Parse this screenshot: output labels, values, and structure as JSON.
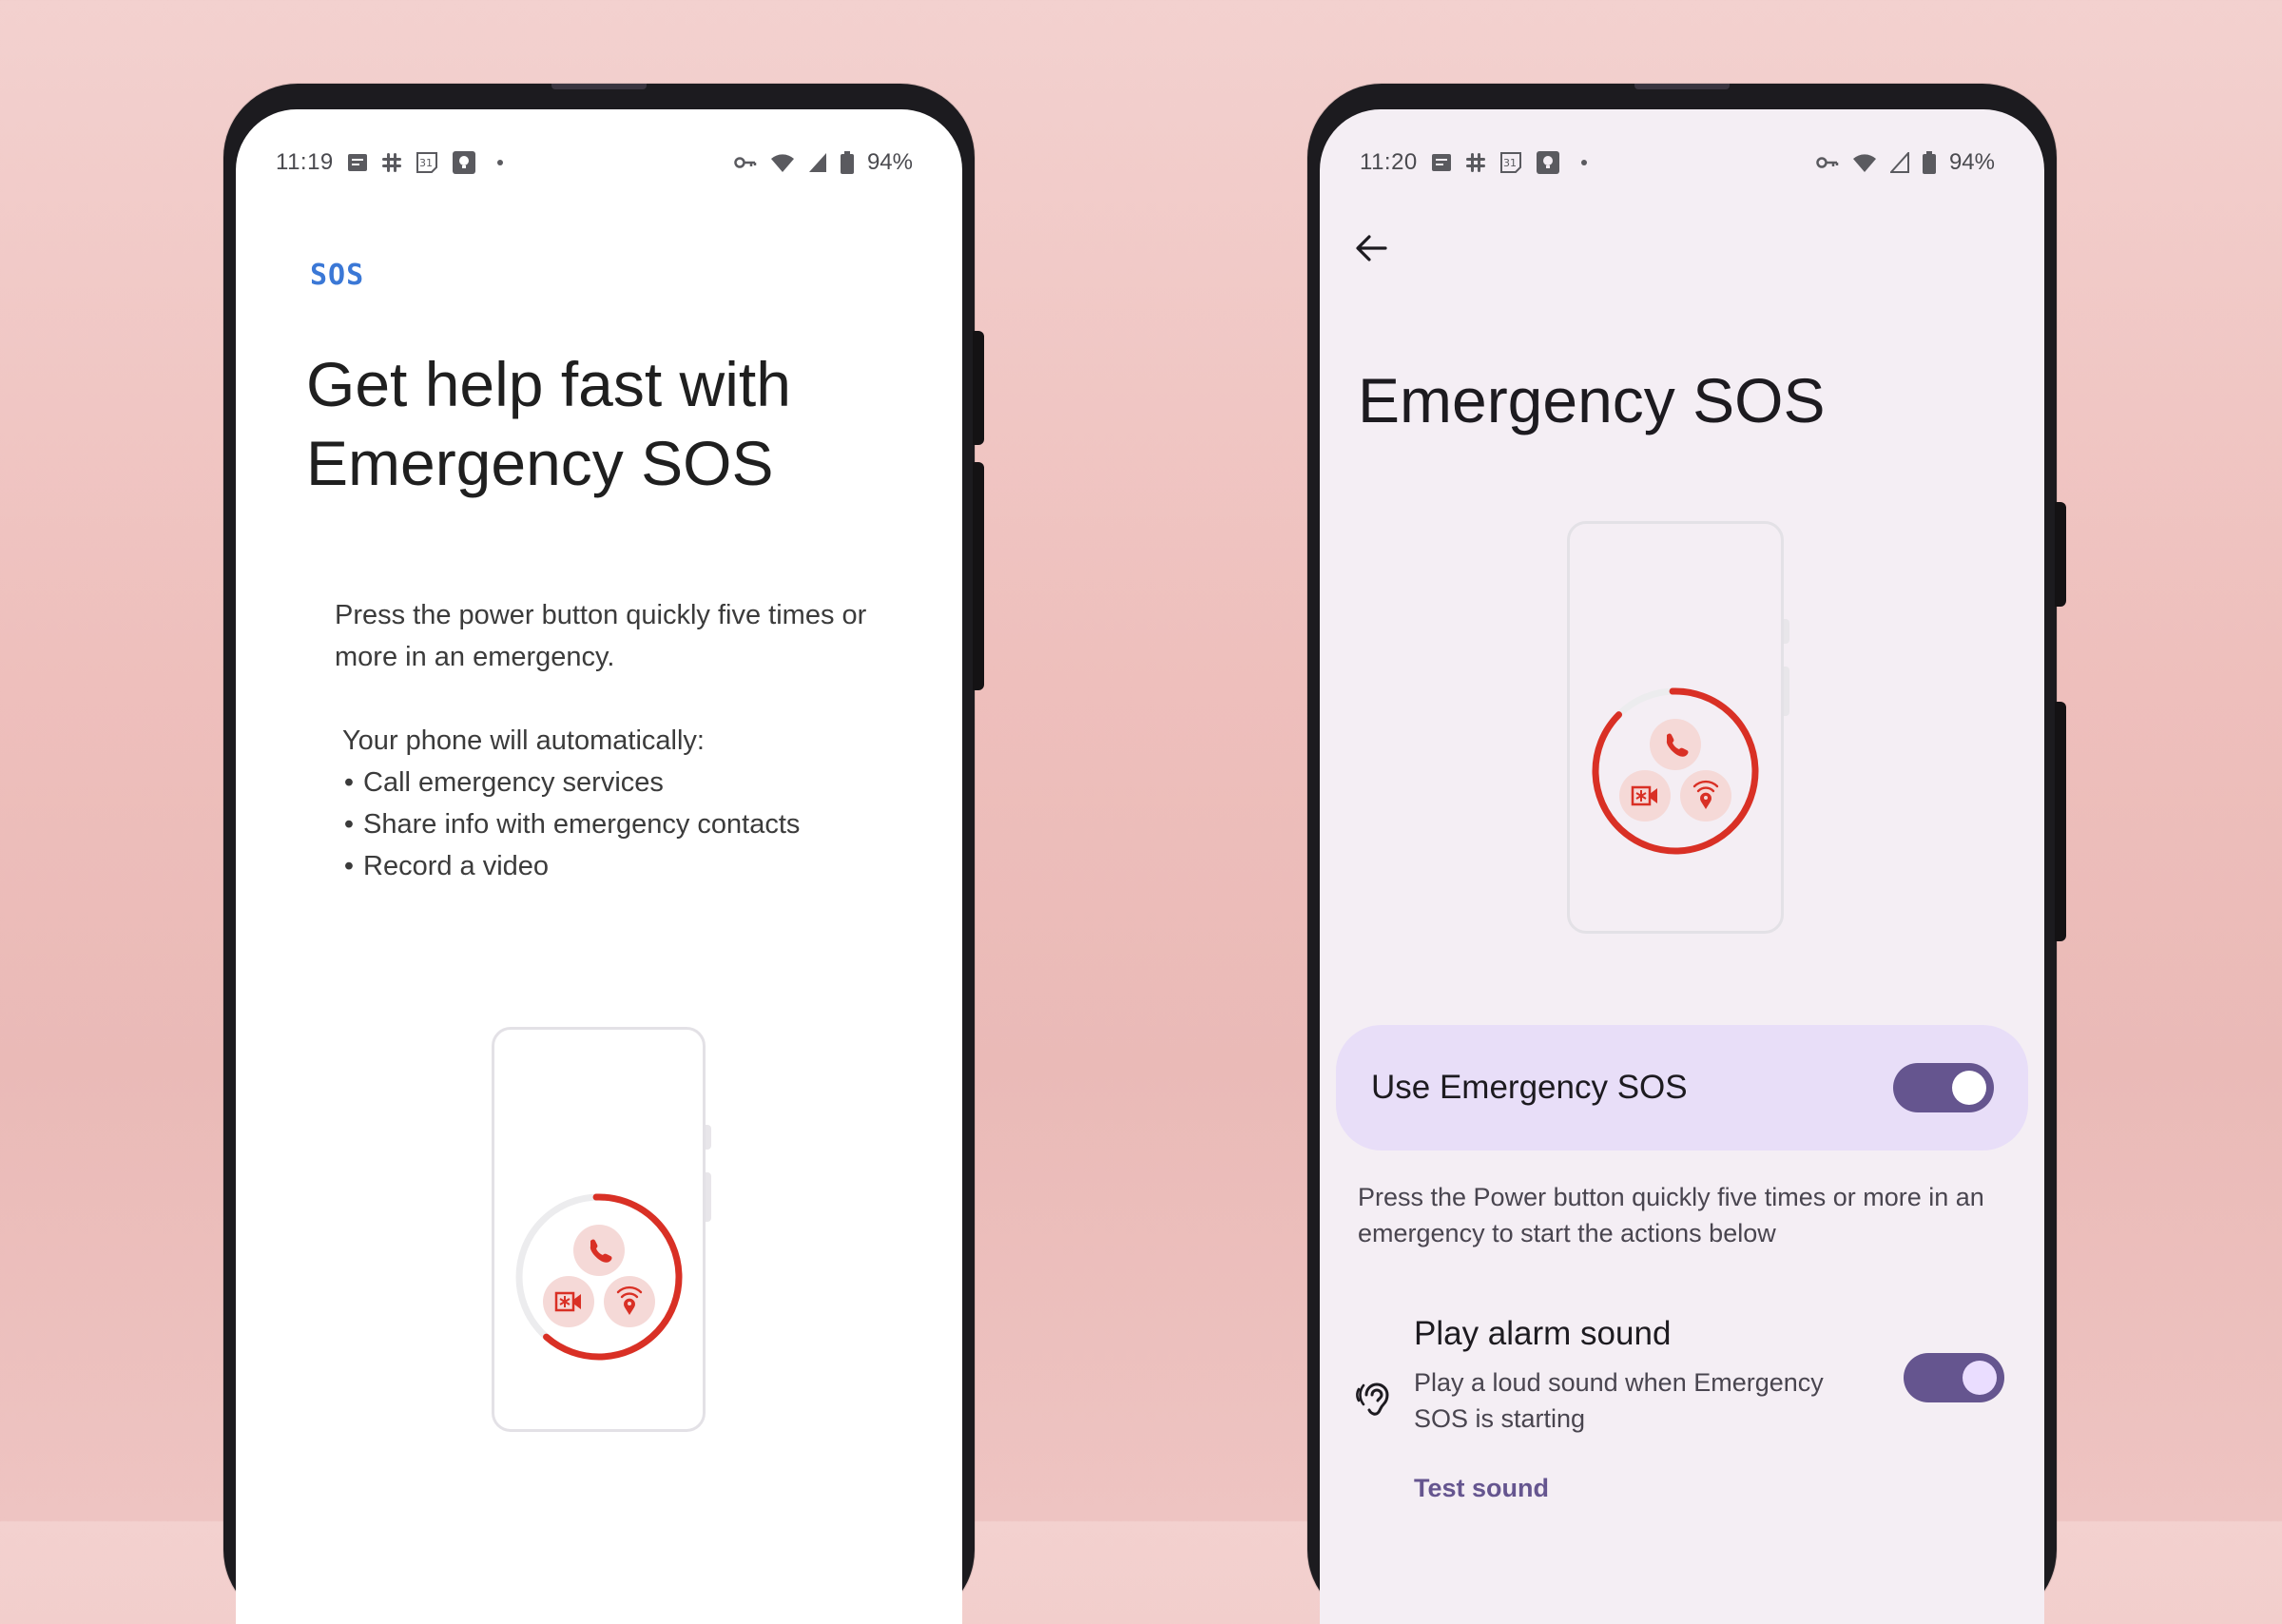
{
  "colors": {
    "background": "#eebfbc",
    "accent_purple": "#65558f",
    "pill_bg": "#e8def8",
    "sos_blue": "#3b78d6",
    "sos_red": "#d93025",
    "icon_bg": "#f5d9d7"
  },
  "left_phone": {
    "status_bar": {
      "time": "11:19",
      "left_icons": [
        "messages-icon",
        "slack-icon",
        "calendar-icon",
        "keep-icon",
        "more-dot"
      ],
      "calendar_day": "31",
      "right_icons": [
        "vpn-key-icon",
        "wifi-icon",
        "signal-icon",
        "battery-icon"
      ],
      "battery": "94%"
    },
    "logo": "SOS",
    "title": "Get help fast with Emergency SOS",
    "intro": "Press the power button quickly five times or more in an emergency.",
    "auto_heading": "Your phone will automatically:",
    "bullets": [
      "Call emergency services",
      "Share info with emergency contacts",
      "Record a video"
    ],
    "bullet_char": "•",
    "illustration": {
      "icons": [
        "phone-icon",
        "video-record-icon",
        "location-share-icon"
      ],
      "progress": 0.62
    }
  },
  "right_phone": {
    "status_bar": {
      "time": "11:20",
      "left_icons": [
        "messages-icon",
        "slack-icon",
        "calendar-icon",
        "keep-icon",
        "more-dot"
      ],
      "calendar_day": "31",
      "right_icons": [
        "vpn-key-icon",
        "wifi-icon",
        "signal-icon",
        "battery-icon"
      ],
      "battery": "94%"
    },
    "back_icon": "arrow-back-icon",
    "title": "Emergency SOS",
    "illustration": {
      "icons": [
        "phone-icon",
        "video-record-icon",
        "location-share-icon"
      ],
      "progress": 0.88
    },
    "main_toggle": {
      "label": "Use Emergency SOS",
      "on": true
    },
    "description": "Press the Power button quickly five times or more in an emergency to start the actions below",
    "alarm": {
      "icon": "hearing-icon",
      "title": "Play alarm sound",
      "subtitle": "Play a loud sound when Emergency SOS is starting",
      "on": true,
      "test_label": "Test sound"
    }
  }
}
